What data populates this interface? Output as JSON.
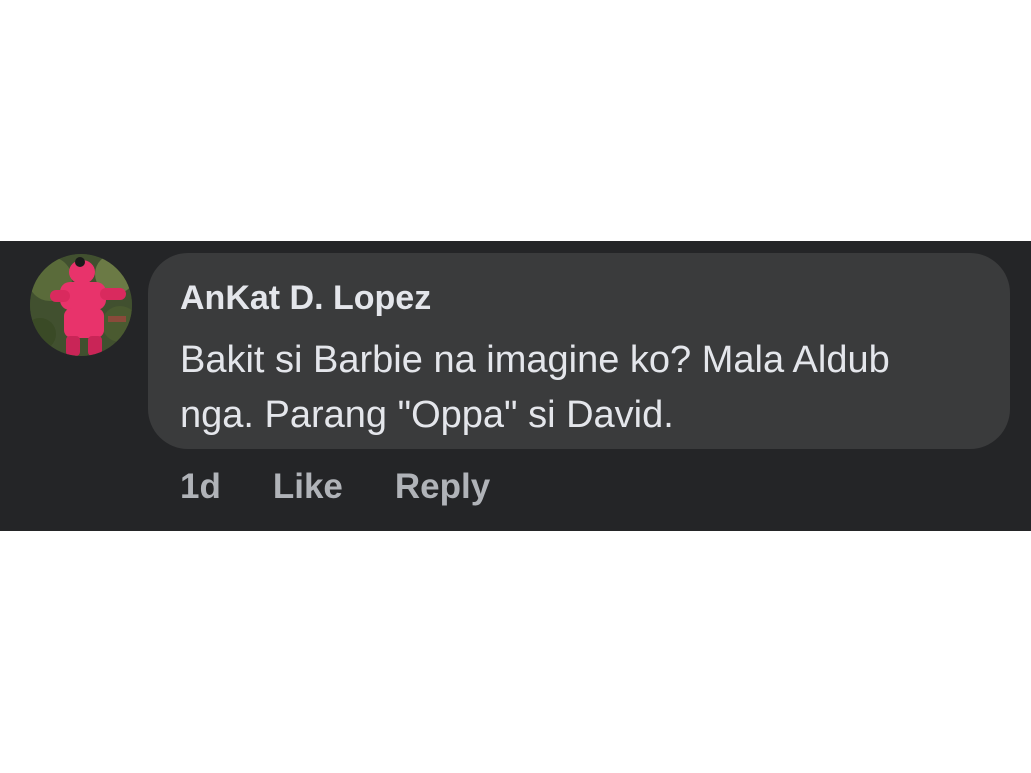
{
  "comment": {
    "author": "AnKat D. Lopez",
    "text": "Bakit si Barbie na imagine ko? Mala Aldub nga. Parang \"Oppa\" si  David.",
    "timestamp": "1d",
    "actions": {
      "like_label": "Like",
      "reply_label": "Reply"
    }
  },
  "colors": {
    "strip_background": "#242527",
    "bubble_background": "#3a3b3c",
    "primary_text": "#e4e6eb",
    "secondary_text": "#b0b3b8",
    "avatar_accent": "#e8336b"
  }
}
